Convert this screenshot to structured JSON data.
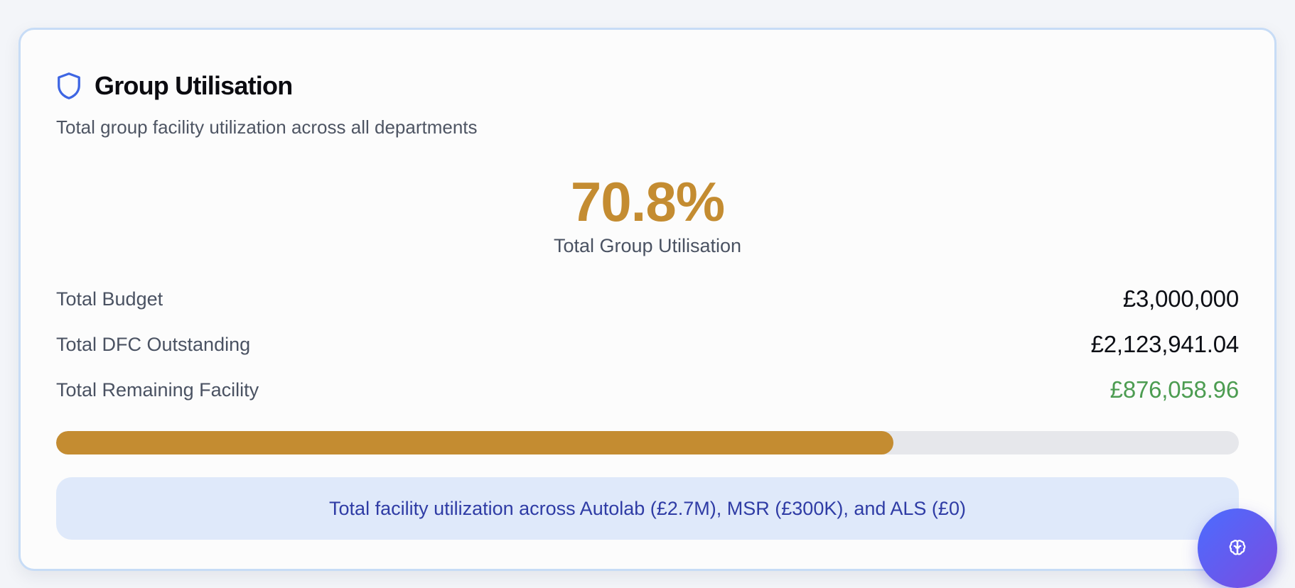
{
  "card": {
    "title": "Group Utilisation",
    "subtitle": "Total group facility utilization across all departments",
    "icon": "shield-icon",
    "accent_color": "#c48c31"
  },
  "metric": {
    "value": "70.8%",
    "label": "Total Group Utilisation"
  },
  "rows": [
    {
      "label": "Total Budget",
      "value": "£3,000,000"
    },
    {
      "label": "Total DFC Outstanding",
      "value": "£2,123,941.04"
    },
    {
      "label": "Total Remaining Facility",
      "value": "£876,058.96",
      "color": "#4c9c51"
    }
  ],
  "progress": {
    "percent": 70.8
  },
  "note": "Total facility utilization across Autolab (£2.7M), MSR (£300K), and ALS (£0)",
  "fab": {
    "icon": "brain-icon"
  }
}
